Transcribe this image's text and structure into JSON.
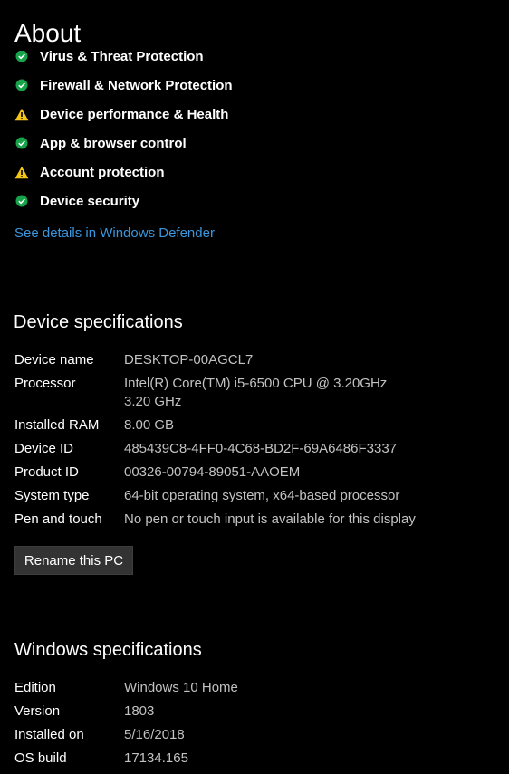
{
  "page": {
    "title": "About"
  },
  "protection": {
    "items": [
      {
        "label": "Virus & Threat Protection",
        "status": "ok",
        "icon": "check-circle-icon"
      },
      {
        "label": "Firewall & Network Protection",
        "status": "ok",
        "icon": "check-circle-icon"
      },
      {
        "label": "Device performance & Health",
        "status": "warning",
        "icon": "warning-icon"
      },
      {
        "label": "App & browser control",
        "status": "ok",
        "icon": "check-circle-icon"
      },
      {
        "label": "Account protection",
        "status": "warning",
        "icon": "warning-icon"
      },
      {
        "label": "Device security",
        "status": "ok",
        "icon": "check-circle-icon"
      }
    ],
    "details_link": "See details in Windows Defender"
  },
  "device_specs": {
    "heading": "Device specifications",
    "rows": [
      {
        "label": "Device name",
        "value": "DESKTOP-00AGCL7"
      },
      {
        "label": "Processor",
        "value": "Intel(R) Core(TM) i5-6500 CPU @ 3.20GHz   3.20 GHz"
      },
      {
        "label": "Installed RAM",
        "value": "8.00 GB"
      },
      {
        "label": "Device ID",
        "value": "485439C8-4FF0-4C68-BD2F-69A6486F3337"
      },
      {
        "label": "Product ID",
        "value": "00326-00794-89051-AAOEM"
      },
      {
        "label": "System type",
        "value": "64-bit operating system, x64-based processor"
      },
      {
        "label": "Pen and touch",
        "value": "No pen or touch input is available for this display"
      }
    ],
    "rename_button": "Rename this PC"
  },
  "windows_specs": {
    "heading": "Windows specifications",
    "rows": [
      {
        "label": "Edition",
        "value": "Windows 10 Home"
      },
      {
        "label": "Version",
        "value": "1803"
      },
      {
        "label": "Installed on",
        "value": "5/16/2018"
      },
      {
        "label": "OS build",
        "value": "17134.165"
      }
    ]
  },
  "colors": {
    "background": "#000000",
    "ok_green": "#16a34a",
    "warning_yellow": "#f5c518",
    "link_blue": "#3a96dd",
    "value_gray": "#c2c2c2",
    "button_bg": "#333333"
  }
}
